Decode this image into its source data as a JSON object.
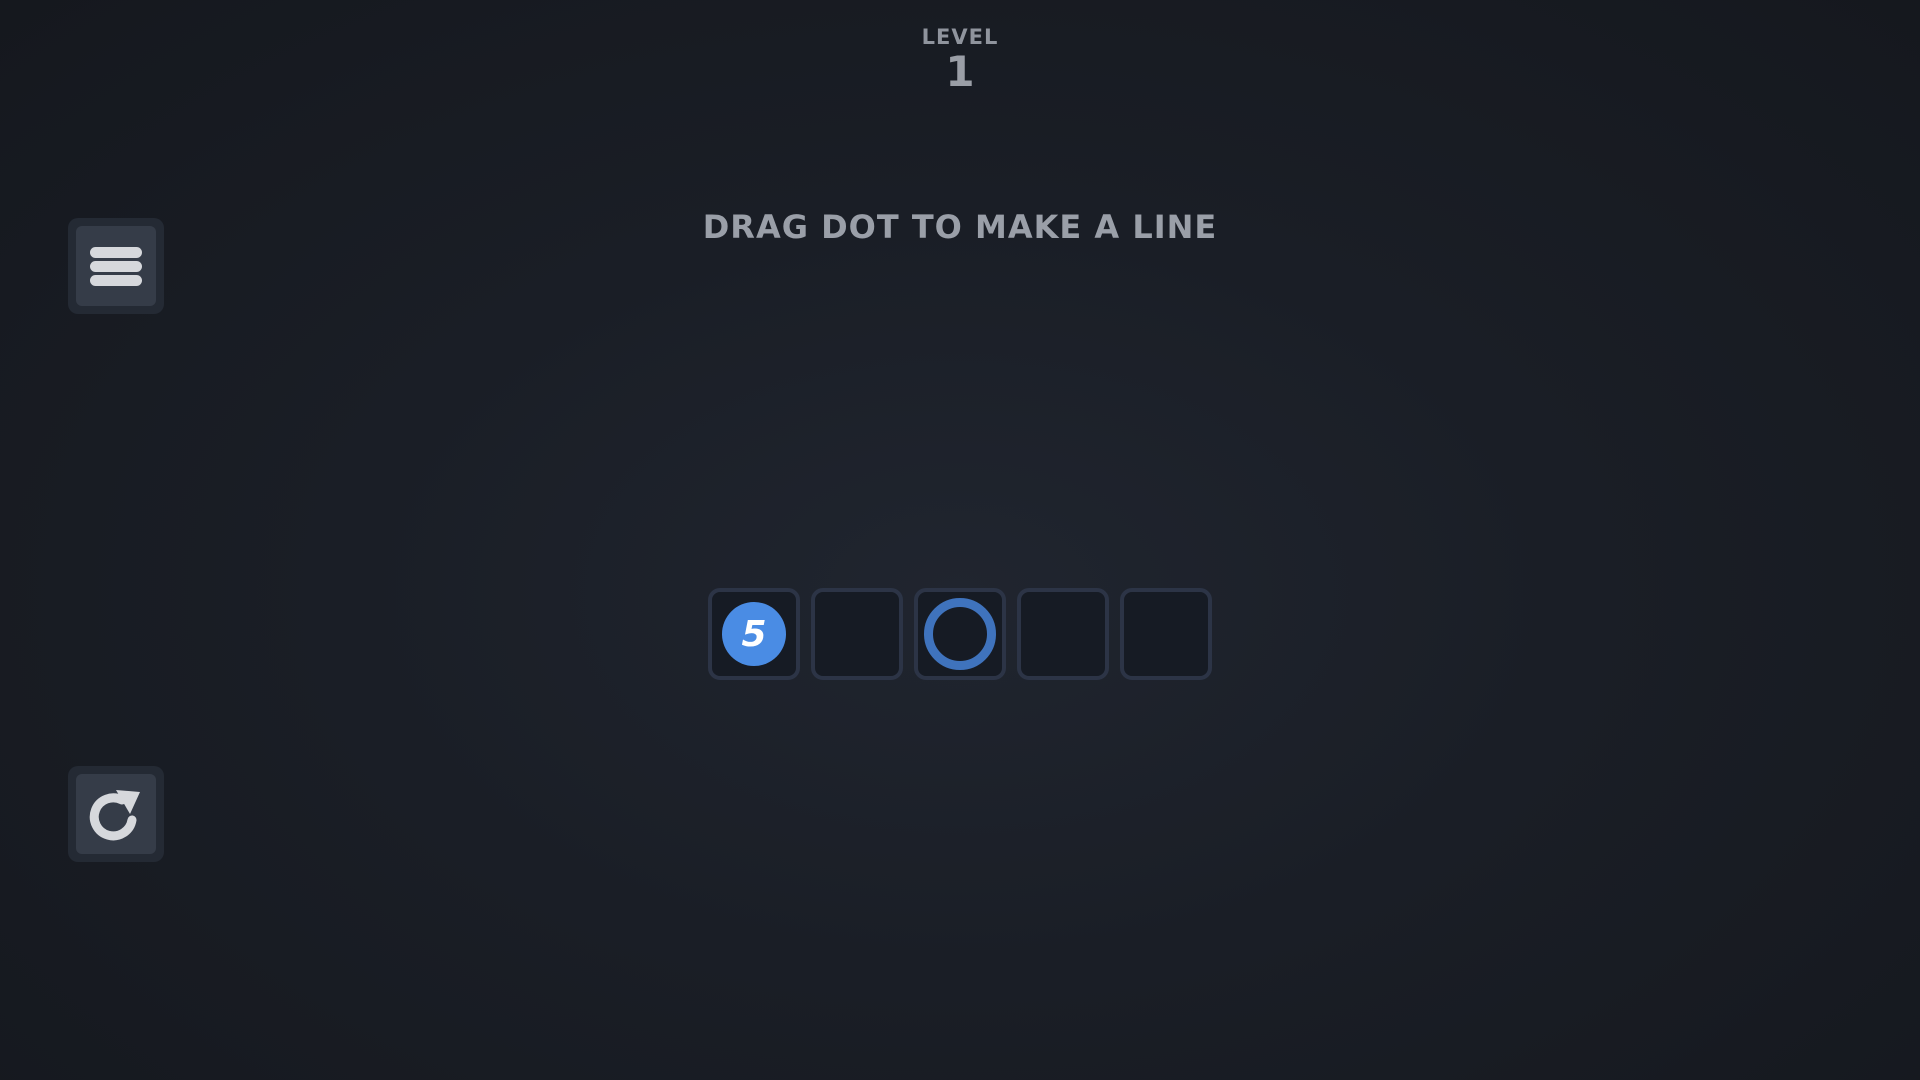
{
  "header": {
    "level_label": "LEVEL",
    "level_number": "1"
  },
  "instruction": "DRAG DOT TO MAKE A LINE",
  "sidebar": {
    "menu_icon": "hamburger-menu-icon",
    "restart_icon": "restart-icon"
  },
  "board": {
    "cells": [
      {
        "state": "dot",
        "number": "5"
      },
      {
        "state": "empty"
      },
      {
        "state": "target-ring"
      },
      {
        "state": "empty"
      },
      {
        "state": "empty"
      }
    ]
  },
  "colors": {
    "background": "#1a1e26",
    "dot": "#4a8ce4",
    "ring": "#3f73bd",
    "cell_border": "#2c3446",
    "button_face": "#353c48"
  }
}
